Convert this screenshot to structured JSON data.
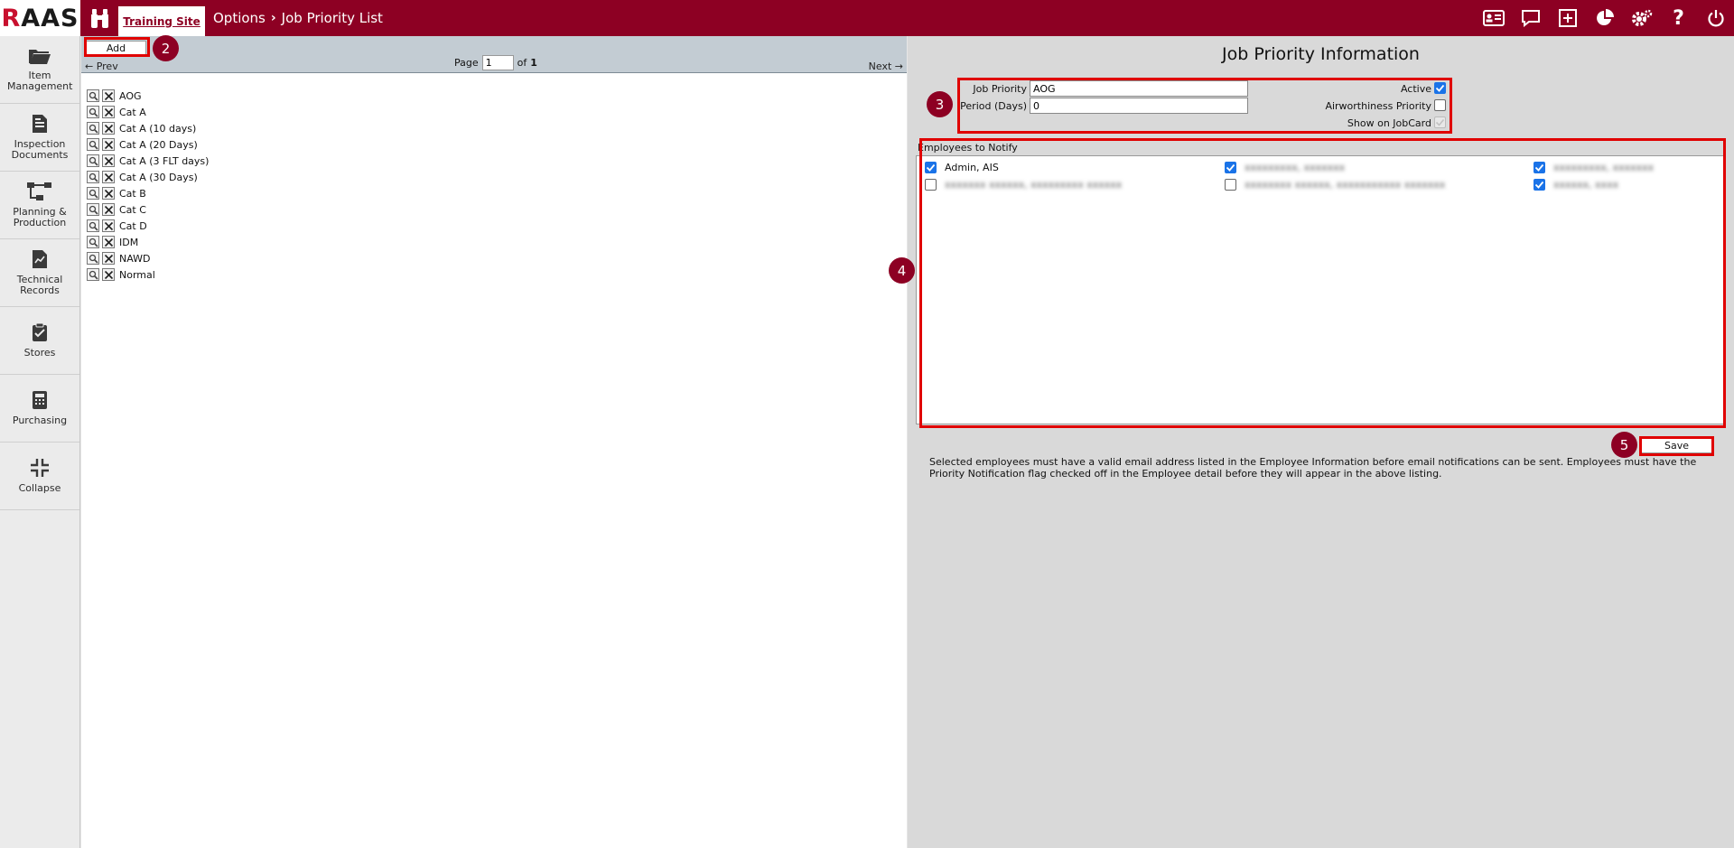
{
  "app": {
    "logo_r": "R",
    "logo_rest": "AAS"
  },
  "header": {
    "site_tab": "Training Site",
    "breadcrumb": [
      "Options",
      "Job Priority List"
    ]
  },
  "top_icons": [
    "id-card-icon",
    "chat-icon",
    "add-box-icon",
    "pie-chart-icon",
    "settings-icon",
    "help-icon",
    "power-icon"
  ],
  "sidebar": {
    "items": [
      {
        "label": "Item Management",
        "icon": "folder-icon"
      },
      {
        "label": "Inspection Documents",
        "icon": "document-icon"
      },
      {
        "label": "Planning & Production",
        "icon": "workflow-icon"
      },
      {
        "label": "Technical Records",
        "icon": "chart-file-icon"
      },
      {
        "label": "Stores",
        "icon": "clipboard-check-icon"
      },
      {
        "label": "Purchasing",
        "icon": "calculator-icon"
      },
      {
        "label": "Collapse",
        "icon": "collapse-icon"
      }
    ]
  },
  "list": {
    "add_label": "Add",
    "prev_label": "← Prev",
    "next_label": "Next →",
    "page_label": "Page",
    "page_value": "1",
    "of_label": "of",
    "page_total": "1",
    "items": [
      "AOG",
      "Cat A",
      "Cat A (10 days)",
      "Cat A (20 Days)",
      "Cat A (3 FLT days)",
      "Cat A (30 Days)",
      "Cat B",
      "Cat C",
      "Cat D",
      "IDM",
      "NAWD",
      "Normal"
    ]
  },
  "detail": {
    "title": "Job Priority Information",
    "job_priority_label": "Job Priority",
    "job_priority_value": "AOG",
    "period_label": "Period (Days)",
    "period_value": "0",
    "active_label": "Active",
    "active_checked": true,
    "airworthiness_label": "Airworthiness Priority",
    "airworthiness_checked": false,
    "show_jobcard_label": "Show on JobCard",
    "show_jobcard_checked": true,
    "employees_label": "Employees to Notify",
    "save_label": "Save",
    "note": "Selected employees must have a valid email address listed in the Employee Information before email notifications can be sent. Employees must have the Priority Notification flag checked off in the Employee detail before they will appear in the above listing."
  },
  "employees": [
    [
      {
        "name": "Admin, AIS",
        "checked": true,
        "blurred": false
      },
      {
        "name": "xxxxxxxxx, xxxxxxx",
        "checked": true,
        "blurred": true
      },
      {
        "name": "xxxxxxxxx, xxxxxxx",
        "checked": true,
        "blurred": true
      }
    ],
    [
      {
        "name": "xxxxxxx xxxxxx, xxxxxxxxx xxxxxx",
        "checked": false,
        "blurred": true
      },
      {
        "name": "xxxxxxxx xxxxxx, xxxxxxxxxxx xxxxxxx",
        "checked": false,
        "blurred": true
      },
      {
        "name": "xxxxxx, xxxx",
        "checked": true,
        "blurred": true
      }
    ]
  ],
  "annotations": [
    "2",
    "3",
    "4",
    "5"
  ],
  "colors": {
    "brand": "#8d0023",
    "highlight": "#e00000",
    "checkbox": "#1a73e8"
  }
}
